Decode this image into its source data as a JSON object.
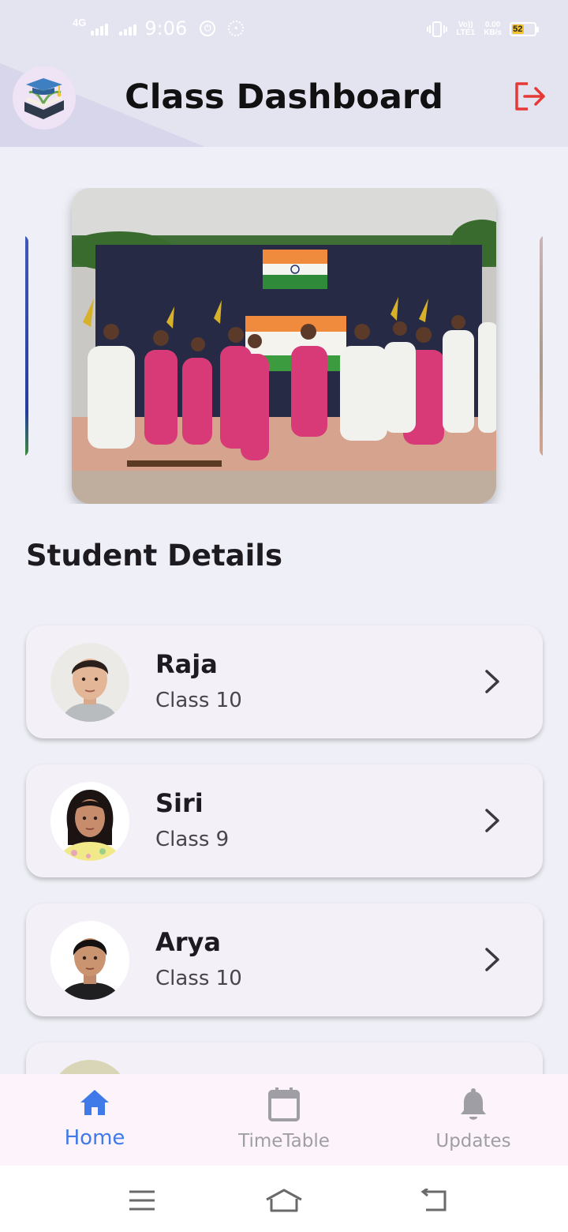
{
  "status_bar": {
    "network": "4G",
    "time": "9:06",
    "volte_label": "Vo)) LTE1",
    "speed_value": "0.00",
    "speed_unit": "KB/s",
    "battery": "52",
    "battery_color": "#f4c430"
  },
  "header": {
    "title": "Class Dashboard",
    "logo_icon": "graduation-book-icon",
    "logout_icon": "logout-icon",
    "logout_color": "#e53935"
  },
  "carousel": {
    "image_description_icon": "event-photo",
    "slides_visible": 3
  },
  "section": {
    "title": "Student Details"
  },
  "students": [
    {
      "name": "Raja",
      "class": "Class 10"
    },
    {
      "name": "Siri",
      "class": "Class 9"
    },
    {
      "name": "Arya",
      "class": "Class 10"
    },
    {
      "name": "",
      "class": ""
    }
  ],
  "bottom_nav": {
    "items": [
      {
        "label": "Home",
        "icon": "home-icon",
        "active": true
      },
      {
        "label": "TimeTable",
        "icon": "calendar-icon",
        "active": false
      },
      {
        "label": "Updates",
        "icon": "bell-icon",
        "active": false
      }
    ],
    "active_color": "#3f7ae8",
    "inactive_color": "#9e9ea4"
  },
  "system_nav": {
    "icons": [
      "menu-icon",
      "home-outline-icon",
      "back-icon"
    ]
  }
}
